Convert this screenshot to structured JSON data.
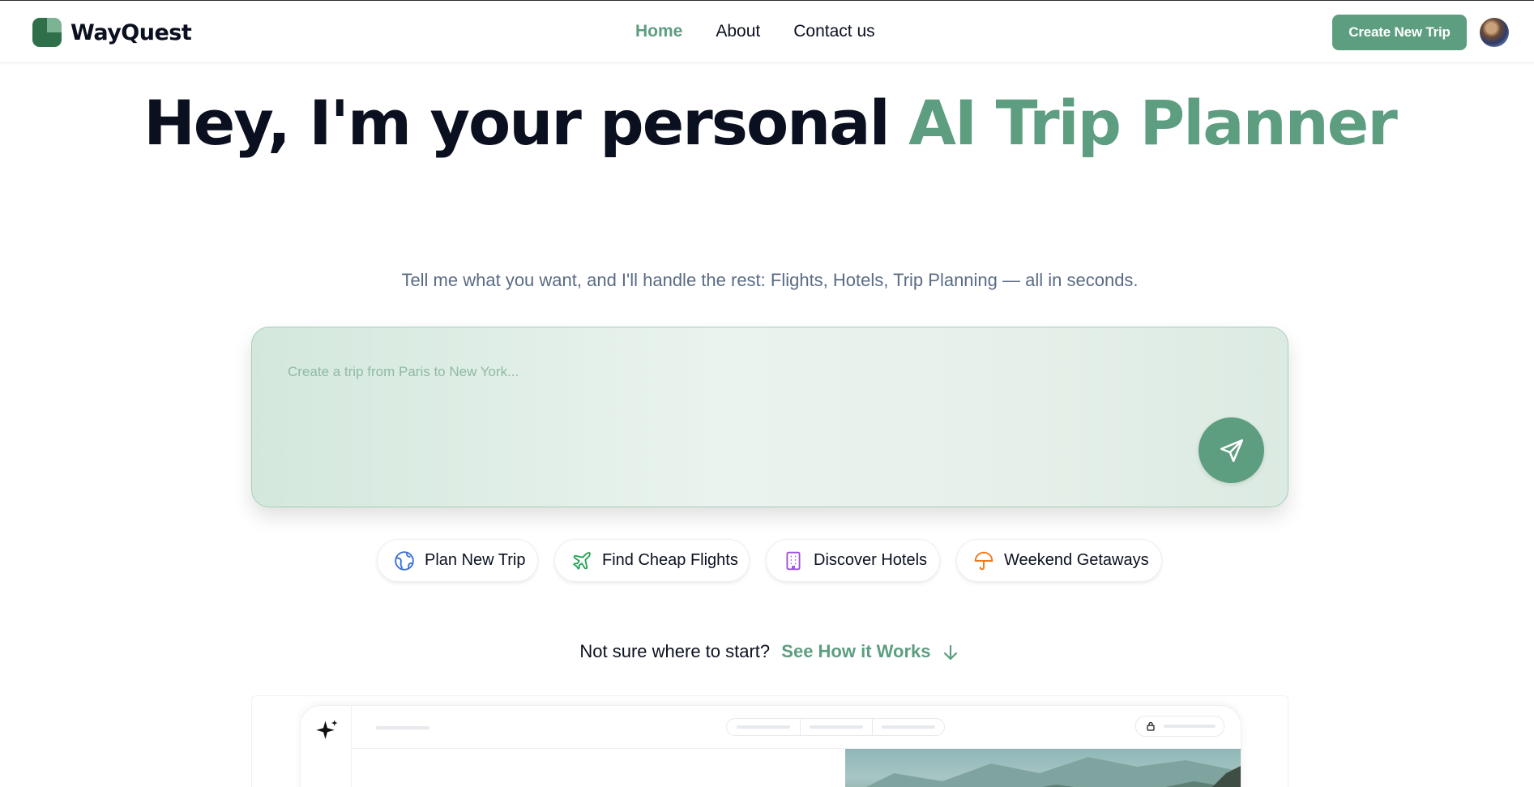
{
  "header": {
    "brand": "WayQuest",
    "nav": [
      {
        "label": "Home",
        "active": true
      },
      {
        "label": "About",
        "active": false
      },
      {
        "label": "Contact us",
        "active": false
      }
    ],
    "cta_label": "Create New Trip",
    "accent_color": "#5c9e7f"
  },
  "hero": {
    "title_main": "Hey, I'm your personal ",
    "title_accent": "AI Trip Planner",
    "subtitle": "Tell me what you want, and I'll handle the rest: Flights, Hotels, Trip Planning — all in seconds."
  },
  "prompt": {
    "placeholder": "Create a trip from Paris to New York...",
    "value": "",
    "send_icon": "send-icon"
  },
  "chips": [
    {
      "label": "Plan New Trip",
      "icon": "globe-icon",
      "color": "#3b6fd6"
    },
    {
      "label": "Find Cheap Flights",
      "icon": "plane-icon",
      "color": "#22a355"
    },
    {
      "label": "Discover Hotels",
      "icon": "building-icon",
      "color": "#9b4fe0"
    },
    {
      "label": "Weekend Getaways",
      "icon": "umbrella-icon",
      "color": "#f07a1a"
    }
  ],
  "how": {
    "question": "Not sure where to start?",
    "link_label": "See How it Works"
  }
}
